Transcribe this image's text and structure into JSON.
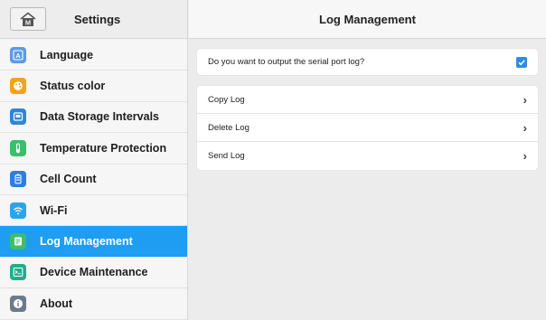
{
  "left": {
    "title": "Settings",
    "items": [
      {
        "label": "Language",
        "icon": "language-icon",
        "color": "#5b9be8",
        "active": false
      },
      {
        "label": "Status color",
        "icon": "palette-icon",
        "color": "#f6a31c",
        "active": false
      },
      {
        "label": "Data Storage Intervals",
        "icon": "storage-icon",
        "color": "#2f86d8",
        "active": false
      },
      {
        "label": "Temperature Protection",
        "icon": "thermometer-icon",
        "color": "#3bbf6b",
        "active": false
      },
      {
        "label": "Cell Count",
        "icon": "battery-icon",
        "color": "#2a7fe0",
        "active": false
      },
      {
        "label": "Wi-Fi",
        "icon": "wifi-icon",
        "color": "#2ca5e8",
        "active": false
      },
      {
        "label": "Log Management",
        "icon": "log-icon",
        "color": "#3bbf6b",
        "active": true
      },
      {
        "label": "Device Maintenance",
        "icon": "terminal-icon",
        "color": "#1fae8a",
        "active": false
      },
      {
        "label": "About",
        "icon": "info-icon",
        "color": "#6c7a8c",
        "active": false
      }
    ]
  },
  "right": {
    "title": "Log Management",
    "serial_option": {
      "label": "Do you want to output the serial port log?",
      "checked": true
    },
    "actions": [
      {
        "label": "Copy Log"
      },
      {
        "label": "Delete Log"
      },
      {
        "label": "Send Log"
      }
    ]
  }
}
